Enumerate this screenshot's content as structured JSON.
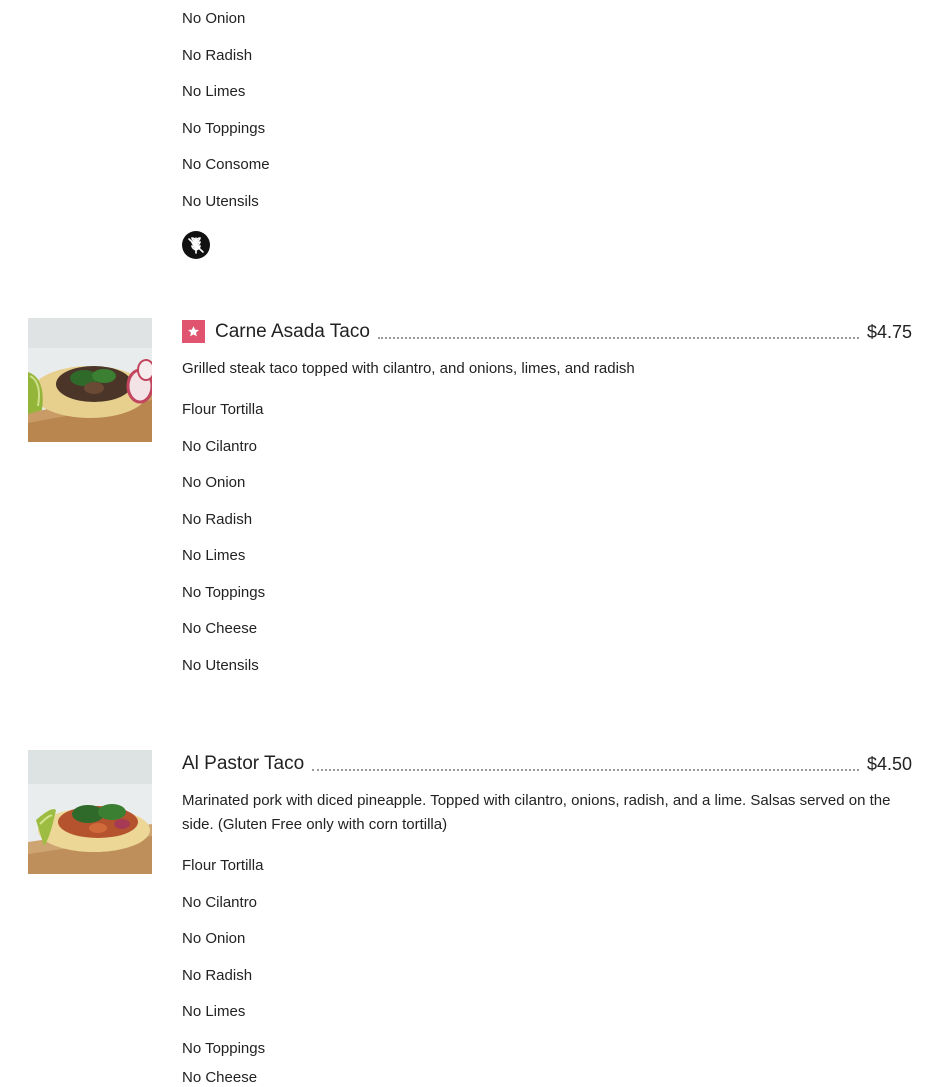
{
  "prev_item": {
    "options": [
      "No Onion",
      "No Radish",
      "No Limes",
      "No Toppings",
      "No Consome",
      "No Utensils"
    ],
    "dietary_icon": "gluten-free-icon"
  },
  "items": [
    {
      "title": "Carne Asada Taco",
      "price": "$4.75",
      "badge_icon": "star-badge-icon",
      "description": "Grilled steak taco topped with cilantro, and onions, limes, and radish",
      "options": [
        "Flour Tortilla",
        "No Cilantro",
        "No Onion",
        "No Radish",
        "No Limes",
        "No Toppings",
        "No Cheese",
        "No Utensils"
      ]
    },
    {
      "title": "Al Pastor Taco",
      "price": "$4.50",
      "description": "Marinated pork with diced pineapple. Topped with cilantro, onions, radish, and a lime. Salsas served on the side. (Gluten Free only with corn tortilla)",
      "options": [
        "Flour Tortilla",
        "No Cilantro",
        "No Onion",
        "No Radish",
        "No Limes",
        "No Toppings",
        "No Cheese"
      ]
    }
  ],
  "colors": {
    "badge": "#e0546f",
    "text": "#222222",
    "dots": "#9a9a9a"
  }
}
